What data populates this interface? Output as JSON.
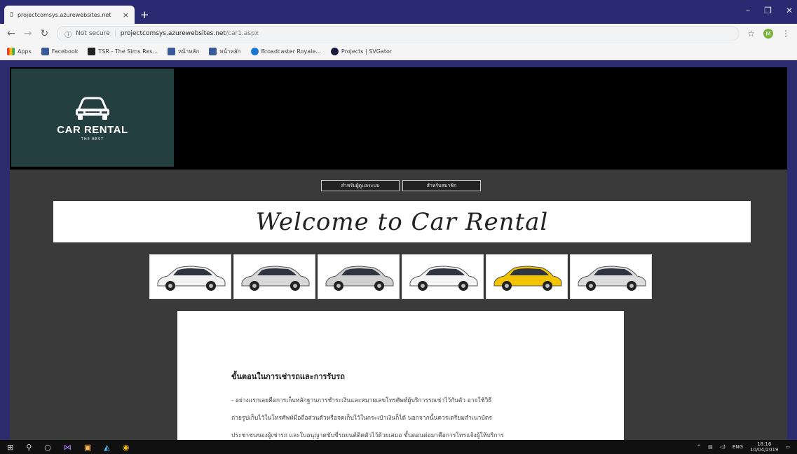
{
  "browser": {
    "tab_title": "projectcomsys.azurewebsites.net",
    "tab_close": "×",
    "new_tab": "+",
    "address": {
      "security": "Not secure",
      "host": "projectcomsys.azurewebsites.net",
      "path": "/car1.aspx"
    },
    "profile_initial": "M",
    "bookmarks": [
      {
        "label": "Apps",
        "color": "#e34133"
      },
      {
        "label": "Facebook",
        "color": "#3b5998"
      },
      {
        "label": "TSR - The Sims Res...",
        "color": "#222222"
      },
      {
        "label": "หน้าหลัก",
        "color": "#3b5998"
      },
      {
        "label": "หน้าหลัก",
        "color": "#3b5998"
      },
      {
        "label": "Broadcaster Royale...",
        "color": "#1976d2"
      },
      {
        "label": "Projects | SVGator",
        "color": "#1a1a40"
      }
    ]
  },
  "site": {
    "logo_title": "CAR RENTAL",
    "logo_subtitle": "THE BEST",
    "nav_buttons": [
      "สำหรับผู้ดูแลระบบ",
      "สำหรับสมาชิก"
    ],
    "welcome_text": "Welcome to Car Rental",
    "cars": [
      {
        "name": "white sedan",
        "body": "#f1f1f1"
      },
      {
        "name": "silver suv",
        "body": "#d8d8d8"
      },
      {
        "name": "silver 4x4 suv",
        "body": "#cfcfcf"
      },
      {
        "name": "white compact sedan",
        "body": "#f4f4f4"
      },
      {
        "name": "yellow hatchback",
        "body": "#f2c400"
      },
      {
        "name": "silver van",
        "body": "#dcdcdc"
      }
    ],
    "content_heading": "ขั้นตอนในการเช่ารถและการรับรถ",
    "content_lines": [
      "- อย่างแรกเลยคือการเก็บหลักฐานการชำระเงินและหมายเลขโทรศัพท์ผู้บริการรถเช่าไว้กับตัว อาจใช้วิธี",
      "ถ่ายรูปเก็บไว้ในโทรศัพท์มือถือส่วนตัวหรือจดเก็บไว้ในกระเป๋าเงินก็ได้ นอกจากนั้นควรเตรียมสำเนาบัตร",
      "ประชาชนของผู้เช่ารถ และใบอนุญาตขับขี่รถยนต์ติดตัวไว้ด้วยเสมอ ขั้นตอนต่อมาคือการโทรแจ้งผู้ให้บริการ"
    ]
  },
  "taskbar": {
    "lang": "ENG",
    "time": "18:16",
    "date": "10/04/2019"
  }
}
